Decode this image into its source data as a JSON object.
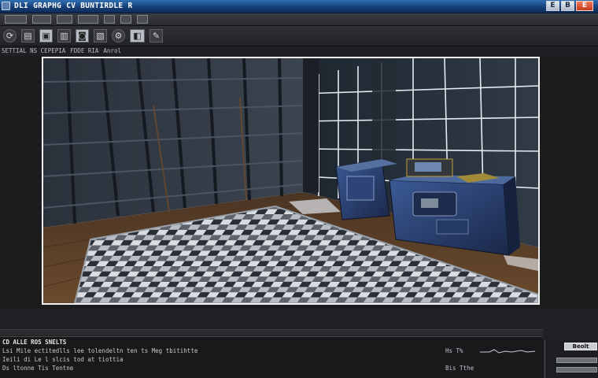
{
  "window": {
    "title": "DLI GRAPHG CV BUNTIRDLE R",
    "controls": {
      "first": "E",
      "second": "B",
      "close": "E"
    }
  },
  "tabs": {
    "label_1": "SETTIAL NS CEPEPIA",
    "label_2": "FDDE RIA",
    "label_3": "Anrol"
  },
  "console": {
    "header": "CD ALLE ROS SNELTS",
    "line_1": "Lsi Mile ectitedlls lee tolendeltn ten ts Meg tbitihtte",
    "line_2": "Ieili di Le l slcis tod at tiottia",
    "line_3": "Ds ltonne Tis Tentne"
  },
  "readout": {
    "line_1": "Hs T%",
    "line_2": "Bis Tthe"
  },
  "dock": {
    "button": "Beolt"
  },
  "colors": {
    "titlebar": "#1f4f8c",
    "background": "#1b1c1e",
    "viewport_border": "#f2f2f2",
    "machine_blue": "#263c6e"
  },
  "icons": [
    "window-icon",
    "folder-icon",
    "gear-icon",
    "camera-icon",
    "film-icon",
    "wrench-icon",
    "refresh-icon",
    "layers-icon",
    "image-icon",
    "cube-icon"
  ]
}
